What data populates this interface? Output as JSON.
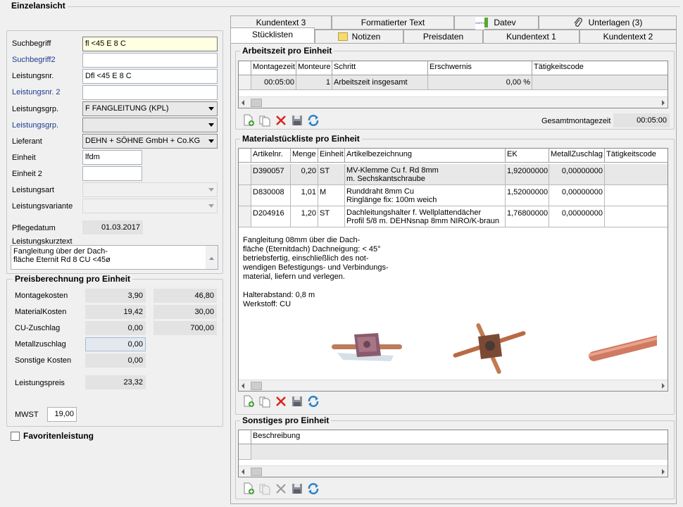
{
  "window": {
    "title": "Einzelansicht"
  },
  "form": {
    "suchbegriff": {
      "label": "Suchbegriff",
      "value": "fl <45 E 8 C"
    },
    "suchbegriff2": {
      "label": "Suchbegriff2",
      "value": ""
    },
    "leistungsnr": {
      "label": "Leistungsnr.",
      "value": "Dfl <45 E 8 C"
    },
    "leistungsnr2": {
      "label": "Leistungsnr. 2",
      "value": ""
    },
    "leistungsgrp": {
      "label": "Leistungsgrp.",
      "value": "F FANGLEITUNG (KPL)"
    },
    "leistungsgrp2": {
      "label": "Leistungsgrp.",
      "value": ""
    },
    "lieferant": {
      "label": "Lieferant",
      "value": "DEHN + SÖHNE GmbH + Co.KG"
    },
    "einheit": {
      "label": "Einheit",
      "value": "lfdm"
    },
    "einheit2": {
      "label": "Einheit 2",
      "value": ""
    },
    "leistungsart": {
      "label": "Leistungsart",
      "value": ""
    },
    "leistungsvariante": {
      "label": "Leistungsvariante",
      "value": ""
    },
    "pflegedatum": {
      "label": "Pflegedatum",
      "value": "01.03.2017"
    },
    "kurztext": {
      "label": "Leistungskurztext",
      "value": "Fangleitung über der Dach-\nfläche Eternit Rd 8 CU <45ø"
    }
  },
  "preis": {
    "title": "Preisberechnung pro Einheit",
    "montage": {
      "label": "Montagekosten",
      "v1": "3,90",
      "v2": "46,80"
    },
    "material": {
      "label": "MaterialKosten",
      "v1": "19,42",
      "v2": "30,00"
    },
    "cu": {
      "label": "CU-Zuschlag",
      "v1": "0,00",
      "v2": "700,00"
    },
    "metall": {
      "label": "Metallzuschlag",
      "v1": "0,00"
    },
    "sonstige": {
      "label": "Sonstige Kosten",
      "v1": "0,00"
    },
    "leistungspreis": {
      "label": "Leistungspreis",
      "v1": "23,32"
    },
    "mwst": {
      "label": "MWST",
      "value": "19,00"
    }
  },
  "favoriten": {
    "label": "Favoritenleistung"
  },
  "tabs": {
    "row1": [
      "Kundentext 3",
      "Formatierter Text",
      "Datev",
      "Unterlagen (3)"
    ],
    "row2": [
      "Stücklisten",
      "Notizen",
      "Preisdaten",
      "Kundentext 1",
      "Kundentext 2"
    ]
  },
  "datev_logo": "DATEV",
  "arbeitszeit": {
    "title": "Arbeitszeit pro Einheit",
    "headers": [
      "Montagezeit",
      "Monteure",
      "Schritt",
      "Erschwernis",
      "Tätigkeitscode"
    ],
    "row": [
      "00:05:00",
      "1",
      "Arbeitszeit insgesamt",
      "0,00 %",
      ""
    ],
    "gesamt_label": "Gesamtmontagezeit",
    "gesamt_value": "00:05:00"
  },
  "material": {
    "title": "Materialstückliste pro Einheit",
    "headers": [
      "Artikelnr.",
      "Menge",
      "Einheit",
      "Artikelbezeichnung",
      "EK",
      "MetallZuschlag",
      "Tätigkeitscode"
    ],
    "rows": [
      {
        "nr": "D390057",
        "menge": "0,20",
        "einheit": "ST",
        "bez": "MV-Klemme Cu f. Rd 8mm\nm. Sechskantschraube",
        "ek": "1,92000000",
        "mz": "0,00000000",
        "tc": ""
      },
      {
        "nr": "D830008",
        "menge": "1,01",
        "einheit": "M",
        "bez": "Runddraht 8mm Cu\nRinglänge fix: 100m weich",
        "ek": "1,52000000",
        "mz": "0,00000000",
        "tc": ""
      },
      {
        "nr": "D204916",
        "menge": "1,20",
        "einheit": "ST",
        "bez": "Dachleitungshalter f. Wellplattendächer\nProfil 5/8 m. DEHNsnap 8mm NIRO/K-braun",
        "ek": "1,76800000",
        "mz": "0,00000000",
        "tc": ""
      }
    ],
    "longtext": "Fangleitung 08mm über die Dach-\nfläche (Eternitdach) Dachneigung: < 45°\nbetriebsfertig, einschließlich des not-\nwendigen Befestigungs- und Verbindungs-\nmaterial, liefern und verlegen.\n\nHalterabstand: 0,8 m\nWerkstoff: CU"
  },
  "sonstiges": {
    "title": "Sonstiges pro Einheit",
    "headers": [
      "Beschreibung"
    ]
  },
  "toolbar_icons": [
    "add-icon",
    "copy-icon",
    "delete-icon",
    "save-icon",
    "refresh-icon"
  ],
  "colors": {
    "delete": "#d9241a",
    "add": "#3a9a2b",
    "selection": "#e8e8e8"
  }
}
